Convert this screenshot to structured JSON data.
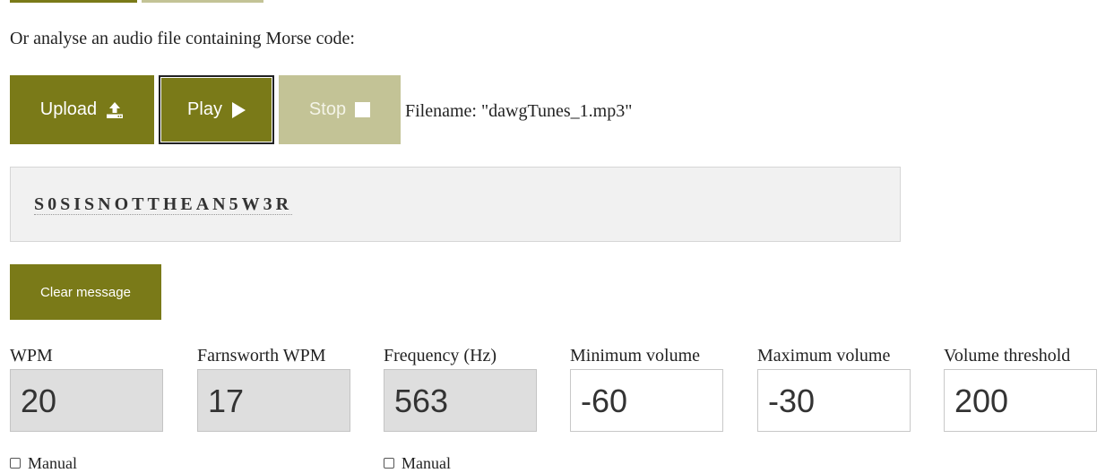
{
  "intro_text": "Or analyse an audio file containing Morse code:",
  "buttons": {
    "upload": "Upload",
    "play": "Play",
    "stop": "Stop",
    "clear": "Clear message"
  },
  "file": {
    "label": "Filename:",
    "name": "\"dawgTunes_1.mp3\""
  },
  "message": "S0SISNOTTHEAN5W3R",
  "fields": [
    {
      "label": "WPM",
      "value": "20",
      "disabled": true
    },
    {
      "label": "Farnsworth WPM",
      "value": "17",
      "disabled": true
    },
    {
      "label": "Frequency (Hz)",
      "value": "563",
      "disabled": true
    },
    {
      "label": "Minimum volume",
      "value": "-60",
      "disabled": false
    },
    {
      "label": "Maximum volume",
      "value": "-30",
      "disabled": false
    },
    {
      "label": "Volume threshold",
      "value": "200",
      "disabled": false
    }
  ],
  "manual_label": "Manual",
  "colors": {
    "accent": "#7a7a18",
    "accent_disabled": "#c3c396",
    "message_bg": "#f1f1f1",
    "input_disabled_bg": "#dedede"
  },
  "icons": {
    "upload": "upload-icon",
    "play": "play-icon",
    "stop": "stop-icon"
  }
}
